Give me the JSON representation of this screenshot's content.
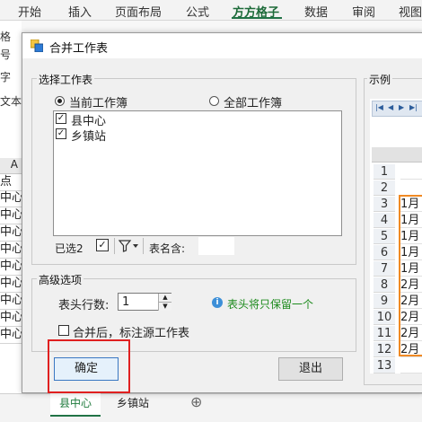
{
  "ribbon": {
    "tabs": [
      "开始",
      "插入",
      "页面布局",
      "公式",
      "方方格子",
      "数据",
      "审阅",
      "视图"
    ],
    "active_tab": "方方格子"
  },
  "background": {
    "ribbon_labels": [
      "格",
      "号",
      "字",
      "文本"
    ],
    "column_header": "A",
    "cells": [
      "点",
      "中心",
      "中心",
      "中心",
      "中心",
      "中心",
      "中心",
      "中心",
      "中心",
      "中心"
    ],
    "sheet_tabs": [
      "县中心",
      "乡镇站"
    ],
    "add_sheet": "⊕"
  },
  "dialog": {
    "title": "合并工作表",
    "select_group": {
      "label": "选择工作表",
      "radio_current": "当前工作簿",
      "radio_all": "全部工作簿",
      "sheets": [
        {
          "name": "县中心",
          "checked": true
        },
        {
          "name": "乡镇站",
          "checked": true
        }
      ],
      "selected_count": "已选2",
      "sheet_name_label": "表名含:",
      "sheet_name_value": ""
    },
    "advanced_group": {
      "label": "高级选项",
      "header_rows_label": "表头行数:",
      "header_rows_value": "1",
      "info_text": "表头将只保留一个",
      "mark_source_label": "合并后，标注源工作表"
    },
    "ok_label": "确定",
    "exit_label": "退出",
    "preview": {
      "label": "示例",
      "row_numbers": [
        "1",
        "2",
        "3",
        "4",
        "5",
        "6",
        "7",
        "8",
        "9",
        "10",
        "11",
        "12",
        "13"
      ],
      "cells": [
        "",
        "",
        "1月",
        "1月",
        "1月",
        "1月",
        "1月",
        "2月",
        "2月",
        "2月",
        "2月",
        "2月",
        ""
      ]
    }
  },
  "colors": {
    "accent": "#217346",
    "highlight": "#e02020",
    "preview_border": "#f08a24",
    "info_text": "#1c8a1c"
  }
}
